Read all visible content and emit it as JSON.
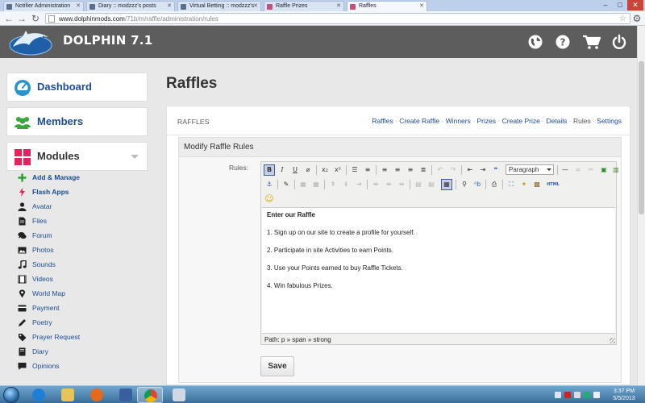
{
  "browser": {
    "tabs": [
      {
        "title": "Notifier Administration",
        "active": false
      },
      {
        "title": "Diary :: modzzz's posts",
        "active": false
      },
      {
        "title": "Virtual Betting :: modzzz's",
        "active": false
      },
      {
        "title": "Raffle Prizes",
        "active": false
      },
      {
        "title": "Raffles",
        "active": true
      }
    ],
    "url_host": "www.dolphinmods.com",
    "url_path": "/71b/m/raffle/administration/rules",
    "window_controls": {
      "minimize": "–",
      "maximize": "□",
      "close": "✕"
    },
    "nav": {
      "back": "←",
      "forward": "→",
      "reload": "↻",
      "star": "☆",
      "menu": "⚙"
    }
  },
  "header": {
    "brand": "DOLPHIN 7.1",
    "icons": [
      "globe-icon",
      "help-icon",
      "cart-icon",
      "power-icon"
    ]
  },
  "sidebar": {
    "sections": [
      {
        "label": "Dashboard",
        "icon": "dashboard-icon"
      },
      {
        "label": "Members",
        "icon": "members-icon"
      },
      {
        "label": "Modules",
        "icon": "modules-icon"
      }
    ],
    "module_items": [
      {
        "label": "Add & Manage",
        "icon": "plus-icon",
        "bold": true
      },
      {
        "label": "Flash Apps",
        "icon": "flash-icon",
        "bold": true
      },
      {
        "label": "Avatar",
        "icon": "person-icon",
        "bold": false
      },
      {
        "label": "Files",
        "icon": "file-icon",
        "bold": false
      },
      {
        "label": "Forum",
        "icon": "chat-icon",
        "bold": false
      },
      {
        "label": "Photos",
        "icon": "photos-icon",
        "bold": false
      },
      {
        "label": "Sounds",
        "icon": "music-icon",
        "bold": false
      },
      {
        "label": "Videos",
        "icon": "film-icon",
        "bold": false
      },
      {
        "label": "World Map",
        "icon": "map-marker-icon",
        "bold": false
      },
      {
        "label": "Payment",
        "icon": "credit-card-icon",
        "bold": false
      },
      {
        "label": "Poetry",
        "icon": "pen-icon",
        "bold": false
      },
      {
        "label": "Prayer Request",
        "icon": "tag-icon",
        "bold": false
      },
      {
        "label": "Diary",
        "icon": "book-icon",
        "bold": false
      },
      {
        "label": "Opinions",
        "icon": "comment-icon",
        "bold": false
      }
    ]
  },
  "main": {
    "page_title": "Raffles",
    "panel_title": "RAFFLES",
    "tabs": [
      {
        "label": "Raffles",
        "active": false
      },
      {
        "label": "Create Raffle",
        "active": false
      },
      {
        "label": "Winners",
        "active": false
      },
      {
        "label": "Prizes",
        "active": false
      },
      {
        "label": "Create Prize",
        "active": false
      },
      {
        "label": "Details",
        "active": false
      },
      {
        "label": "Rules",
        "active": true
      },
      {
        "label": "Settings",
        "active": false
      }
    ],
    "form_title": "Modify Raffle Rules",
    "rules_label": "Rules:",
    "editor": {
      "format_value": "Paragraph",
      "content_heading": "Enter our Raffle",
      "content_lines": [
        "1. Sign up on our site to create a profile for yourself.",
        "2. Participate in site Activities to earn Points.",
        "3. Use your Points earned to buy Raffle Tickets.",
        "4. Win fabulous Prizes."
      ],
      "path": "Path: p » span » strong",
      "html_button": "HTML",
      "emotion_glyph": "☺"
    },
    "save_label": "Save"
  },
  "taskbar": {
    "time": "3:37 PM",
    "date": "5/5/2013"
  },
  "colors": {
    "header_bg": "#5d5d5d",
    "link_blue": "#1a4c94",
    "modules_accent": "#e5245c",
    "members_accent": "#3aa53a",
    "dashboard_accent": "#2a93c9"
  }
}
